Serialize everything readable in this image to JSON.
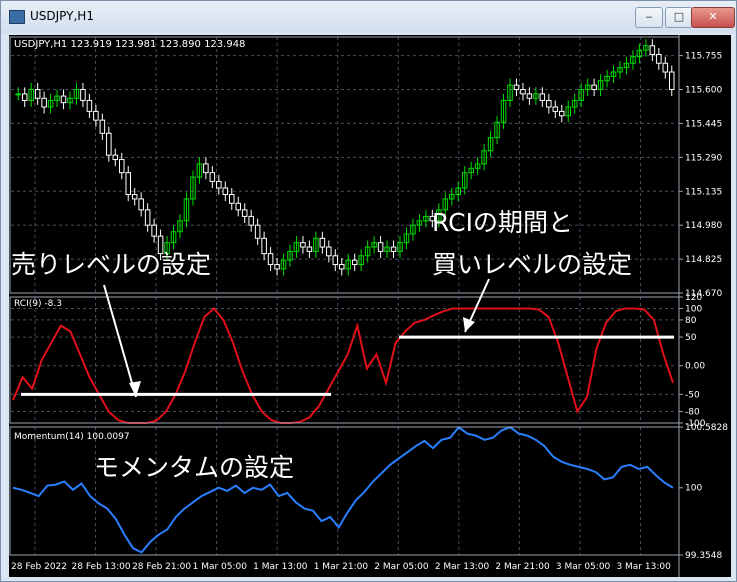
{
  "window": {
    "title": "USDJPY,H1",
    "buttons": {
      "minimize": "‒",
      "maximize": "□",
      "close": "✕"
    }
  },
  "header": {
    "symbol_info": "USDJPY,H1  123.919 123.981 123.890 123.948"
  },
  "annotations": {
    "sell_level": "売りレベルの設定",
    "rci_period_1": "RCIの期間と",
    "rci_period_2": "買いレベルの設定",
    "momentum": "モメンタムの設定"
  },
  "colors": {
    "background": "#000000",
    "grid": "#44505c",
    "bull_candle": "#00dd00",
    "bear_candle": "#ffffff",
    "rci_line": "#e0101a",
    "momentum_line": "#2a7fff",
    "level_line": "#ffffff",
    "text": "#ffffff"
  },
  "chart_data": [
    {
      "type": "candlestick",
      "symbol": "USDJPY",
      "timeframe": "H1",
      "ylim": [
        114.67,
        115.84
      ],
      "yticks": [
        "115.755",
        "115.600",
        "115.445",
        "115.290",
        "115.135",
        "114.980",
        "114.825",
        "114.670"
      ],
      "xticks": [
        "28 Feb 2022",
        "28 Feb 13:00",
        "28 Feb 21:00",
        "1 Mar 05:00",
        "1 Mar 13:00",
        "1 Mar 21:00",
        "2 Mar 05:00",
        "2 Mar 13:00",
        "2 Mar 21:00",
        "3 Mar 05:00",
        "3 Mar 13:00"
      ],
      "close": [
        115.58,
        115.55,
        115.6,
        115.56,
        115.52,
        115.55,
        115.57,
        115.54,
        115.56,
        115.6,
        115.55,
        115.5,
        115.46,
        115.4,
        115.3,
        115.28,
        115.22,
        115.12,
        115.1,
        115.05,
        114.98,
        114.93,
        114.85,
        114.9,
        114.95,
        115.0,
        115.1,
        115.2,
        115.26,
        115.22,
        115.18,
        115.15,
        115.12,
        115.08,
        115.05,
        115.02,
        114.98,
        114.92,
        114.85,
        114.8,
        114.78,
        114.82,
        114.86,
        114.9,
        114.88,
        114.86,
        114.92,
        114.88,
        114.84,
        114.8,
        114.78,
        114.82,
        114.8,
        114.84,
        114.88,
        114.9,
        114.86,
        114.88,
        114.86,
        114.9,
        114.94,
        114.98,
        115.0,
        115.02,
        115.0,
        115.05,
        115.1,
        115.12,
        115.15,
        115.22,
        115.24,
        115.26,
        115.32,
        115.38,
        115.45,
        115.55,
        115.62,
        115.6,
        115.58,
        115.56,
        115.58,
        115.55,
        115.52,
        115.5,
        115.48,
        115.52,
        115.55,
        115.6,
        115.62,
        115.6,
        115.64,
        115.66,
        115.68,
        115.7,
        115.72,
        115.75,
        115.78,
        115.8,
        115.76,
        115.72,
        115.68,
        115.6
      ]
    },
    {
      "type": "line",
      "title": "RCI(9) -8.3",
      "ylim": [
        -100,
        120
      ],
      "yticks": [
        "120",
        "100",
        "80",
        "50",
        "0.00",
        "-50",
        "-80",
        "-100"
      ],
      "levels": [
        50,
        -50
      ],
      "series": [
        {
          "values": [
            -60,
            -20,
            -40,
            10,
            40,
            70,
            60,
            20,
            -20,
            -50,
            -80,
            -95,
            -100,
            -100,
            -100,
            -96,
            -80,
            -50,
            -10,
            40,
            85,
            100,
            80,
            40,
            -10,
            -50,
            -80,
            -95,
            -100,
            -100,
            -98,
            -90,
            -70,
            -40,
            -10,
            20,
            70,
            -5,
            20,
            -30,
            40,
            60,
            75,
            80,
            88,
            95,
            100,
            100,
            100,
            100,
            100,
            100,
            100,
            100,
            100,
            98,
            85,
            40,
            -20,
            -80,
            -55,
            30,
            75,
            95,
            100,
            100,
            98,
            80,
            20,
            -30
          ]
        }
      ]
    },
    {
      "type": "line",
      "title": "Momentum(14) 100.0097",
      "ylim": [
        99.3548,
        100.5828
      ],
      "yticks": [
        "100.5828",
        "100",
        "99.3548"
      ],
      "series": [
        {
          "values": [
            100.0,
            99.98,
            99.95,
            99.92,
            100.02,
            100.03,
            100.06,
            99.98,
            100.04,
            99.92,
            99.85,
            99.8,
            99.7,
            99.55,
            99.42,
            99.38,
            99.48,
            99.55,
            99.6,
            99.72,
            99.8,
            99.86,
            99.92,
            99.96,
            100.0,
            99.97,
            100.02,
            99.95,
            100.0,
            99.98,
            100.03,
            99.92,
            99.95,
            99.86,
            99.8,
            99.78,
            99.68,
            99.72,
            99.62,
            99.76,
            99.88,
            99.96,
            100.06,
            100.14,
            100.22,
            100.28,
            100.34,
            100.4,
            100.45,
            100.38,
            100.46,
            100.48,
            100.58,
            100.52,
            100.5,
            100.46,
            100.48,
            100.55,
            100.58,
            100.52,
            100.5,
            100.46,
            100.4,
            100.3,
            100.25,
            100.22,
            100.2,
            100.18,
            100.15,
            100.08,
            100.1,
            100.2,
            100.22,
            100.18,
            100.2,
            100.12,
            100.05,
            100.0
          ]
        }
      ]
    }
  ]
}
